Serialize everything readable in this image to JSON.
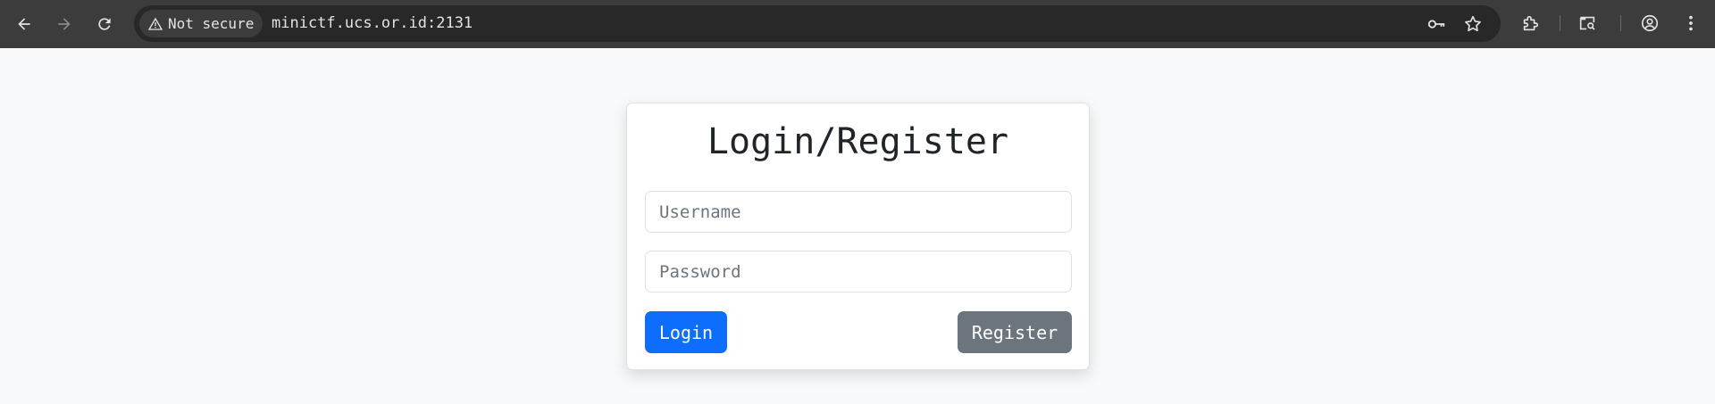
{
  "browser": {
    "security_label": "Not secure",
    "url": "minictf.ucs.or.id:2131",
    "icons": [
      "back-icon",
      "forward-icon",
      "reload-icon",
      "warning-icon",
      "password-key-icon",
      "bookmark-star-icon",
      "extensions-icon",
      "tab-search-icon",
      "profile-icon",
      "menu-icon"
    ]
  },
  "page": {
    "title": "Login/Register",
    "username_placeholder": "Username",
    "password_placeholder": "Password",
    "login_label": "Login",
    "register_label": "Register"
  },
  "colors": {
    "primary": "#0d6efd",
    "secondary": "#6c757d",
    "page_bg": "#f8f9fa",
    "toolbar_bg": "#3c3c3c"
  }
}
